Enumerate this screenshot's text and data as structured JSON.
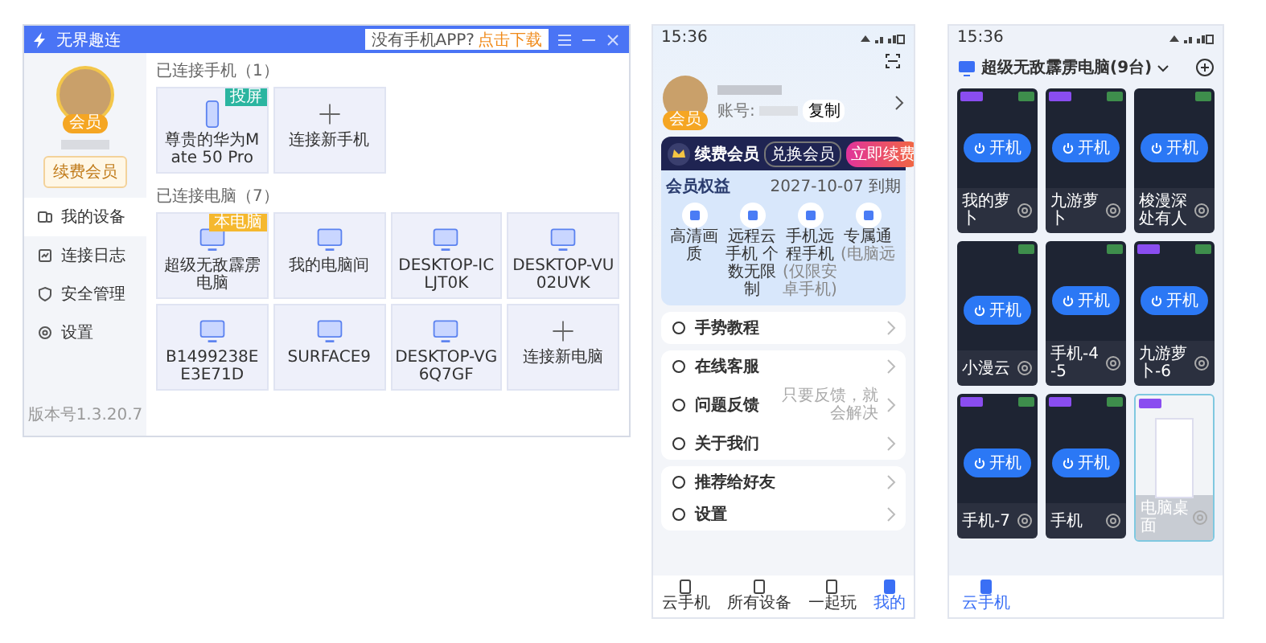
{
  "desktop_window": {
    "title": "无界趣连",
    "download_prompt": "没有手机APP?",
    "download_link": "点击下载",
    "user": {
      "member_badge": "会员",
      "renew_button": "续费会员"
    },
    "nav_items": [
      {
        "label": "我的设备",
        "selected": true
      },
      {
        "label": "连接日志",
        "selected": false
      },
      {
        "label": "安全管理",
        "selected": false
      },
      {
        "label": "设置",
        "selected": false
      }
    ],
    "version": "版本号1.3.20.7",
    "sections": [
      {
        "title": "已连接手机（1）",
        "devices": [
          {
            "kind": "phone",
            "name": "尊贵的华为Mate 50 Pro",
            "tag": "投屏",
            "color": "#2bb5a0"
          },
          {
            "kind": "add",
            "name": "连接新手机"
          }
        ]
      },
      {
        "title": "已连接电脑（7）",
        "devices": [
          {
            "kind": "pc",
            "name": "超级无敌霹雳电脑",
            "tag": "本电脑",
            "color": "#f5b82e"
          },
          {
            "kind": "pc",
            "name": "我的电脑间"
          },
          {
            "kind": "pc",
            "name": "DESKTOP-ICLJT0K"
          },
          {
            "kind": "pc",
            "name": "DESKTOP-VU02UVK"
          },
          {
            "kind": "pc",
            "name": "B1499238EE3E71D"
          },
          {
            "kind": "pc",
            "name": "SURFACE9"
          },
          {
            "kind": "pc",
            "name": "DESKTOP-VG6Q7GF"
          },
          {
            "kind": "add",
            "name": "连接新电脑"
          }
        ]
      }
    ]
  },
  "profile_phone": {
    "status_time": "15:36",
    "member_badge": "会员",
    "account_label": "账号:",
    "copy_button": "复制",
    "vip": {
      "title": "续费会员",
      "redeem_button": "兑换会员",
      "renew_button": "立即续费"
    },
    "benefits": {
      "title": "会员权益",
      "expiry": "2027-10-07 到期",
      "items": [
        {
          "label": "高清画质"
        },
        {
          "label": "远程云手机 个数无限制"
        },
        {
          "label": "手机远程手机",
          "note": "(仅限安卓手机)"
        },
        {
          "label": "专属通",
          "note": "(电脑远"
        }
      ]
    },
    "menu_groups": [
      [
        {
          "label": "手势教程"
        }
      ],
      [
        {
          "label": "在线客服"
        },
        {
          "label": "问题反馈",
          "hint": "只要反馈，就会解决"
        },
        {
          "label": "关于我们"
        }
      ],
      [
        {
          "label": "推荐给好友"
        },
        {
          "label": "设置"
        }
      ]
    ],
    "tabs": [
      {
        "label": "云手机",
        "selected": false
      },
      {
        "label": "所有设备",
        "selected": false
      },
      {
        "label": "一起玩",
        "selected": false
      },
      {
        "label": "我的",
        "selected": true
      }
    ]
  },
  "devices_phone": {
    "status_time": "15:36",
    "title": "超级无敌霹雳电脑(9台)",
    "cards": [
      {
        "kind": "phone",
        "name": "我的萝卜",
        "shared": true,
        "power_button": "开机"
      },
      {
        "kind": "phone",
        "name": "九游萝卜",
        "shared": true,
        "power_button": "开机"
      },
      {
        "kind": "phone",
        "name": "梭漫深处有人",
        "shared": false,
        "power_button": "开机"
      },
      {
        "kind": "phone",
        "name": "小漫云",
        "shared": false,
        "power_button": "开机"
      },
      {
        "kind": "phone",
        "name": "手机-4-5",
        "shared": false,
        "power_button": "开机"
      },
      {
        "kind": "phone",
        "name": "九游萝卜-6",
        "shared": true,
        "power_button": "开机"
      },
      {
        "kind": "phone",
        "name": "手机-7",
        "shared": true,
        "power_button": "开机"
      },
      {
        "kind": "phone",
        "name": "手机",
        "shared": true,
        "power_button": "开机"
      },
      {
        "kind": "desktop",
        "name": "电脑桌面",
        "shared": true
      }
    ],
    "tabs": [
      {
        "label": "云手机",
        "selected": true
      }
    ]
  }
}
